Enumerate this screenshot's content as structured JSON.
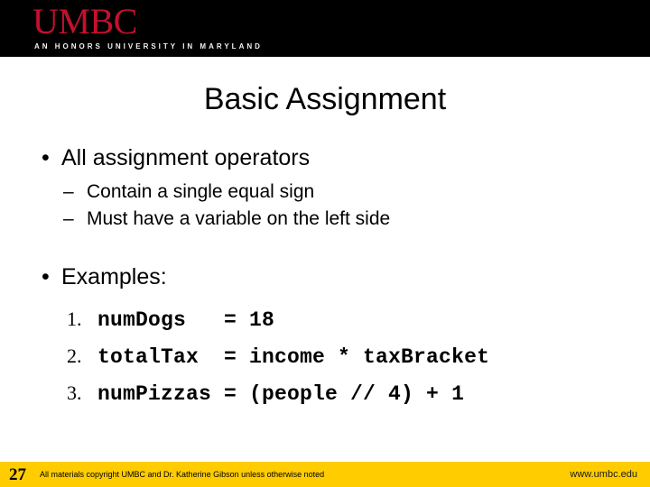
{
  "colors": {
    "header_background": "#000000",
    "logo_red": "#C5102E",
    "footer_background": "#FFCC00",
    "text": "#000000",
    "slide_background": "#FFFFFF"
  },
  "header": {
    "logo_wordmark": "UMBC",
    "logo_tagline": "AN HONORS UNIVERSITY IN MARYLAND"
  },
  "title": "Basic Assignment",
  "body": {
    "bullet1": {
      "marker": "•",
      "text": "All assignment operators",
      "sub_bullets": [
        {
          "marker": "–",
          "text": "Contain a single equal sign"
        },
        {
          "marker": "–",
          "text": "Must have a variable on the left side"
        }
      ]
    },
    "bullet2": {
      "marker": "•",
      "text": "Examples:",
      "code_items": [
        {
          "number": "1.",
          "code": "numDogs   = 18"
        },
        {
          "number": "2.",
          "code": "totalTax  = income * taxBracket"
        },
        {
          "number": "3.",
          "code": "numPizzas = (people // 4) + 1"
        }
      ]
    }
  },
  "footer": {
    "page_number": "27",
    "copyright_note": "All materials copyright UMBC and Dr. Katherine Gibson unless otherwise noted",
    "url": "www.umbc.edu"
  }
}
